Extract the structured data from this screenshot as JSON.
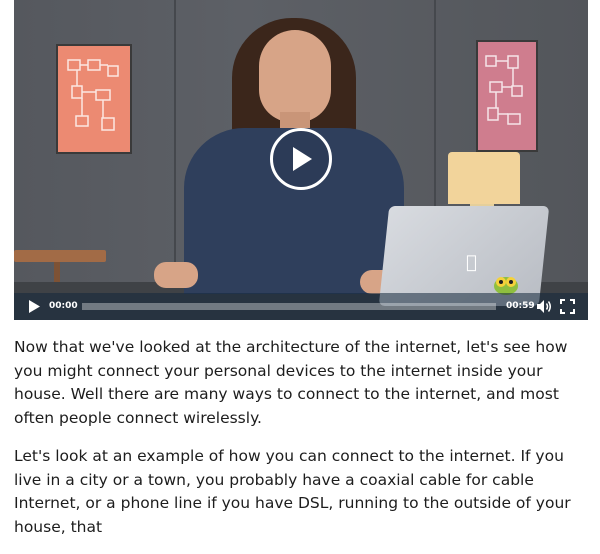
{
  "video": {
    "current_time": "00:00",
    "duration": "00:59",
    "progress": 0,
    "controls": {
      "play": "play-icon",
      "volume": "volume-icon",
      "fullscreen": "fullscreen-icon",
      "center_play": "play-circle-icon"
    }
  },
  "article": {
    "paragraphs": [
      "Now that we've looked at the architecture of the internet, let's see how you might connect your personal devices to the internet inside your house. Well there are many ways to connect to the internet, and most often people connect wirelessly.",
      "Let's look at an example of how you can connect to the internet. If you live in a city or a town, you probably have a coaxial cable for cable Internet, or a phone line if you have DSL, running to the outside of your house, that"
    ]
  },
  "colors": {
    "control_bar": "#14283c",
    "text": "#1d1d1d"
  }
}
